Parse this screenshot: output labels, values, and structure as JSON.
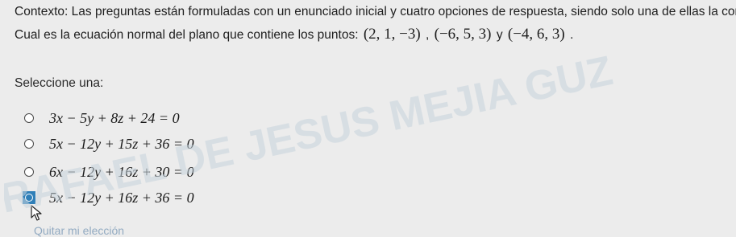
{
  "context": "Contexto: Las preguntas están formuladas con un enunciado inicial y cuatro opciones de respuesta, siendo solo una de ellas la corr",
  "question": {
    "text_before": "Cual es la ecuación normal del plano que contiene los puntos: ",
    "point_1": "(2, 1, −3)",
    "sep_1": " , ",
    "point_2": "(−6, 5, 3)",
    "sep_2": " y ",
    "point_3": "(−4, 6, 3)",
    "text_after": " ."
  },
  "select_label": "Seleccione una:",
  "options": [
    {
      "equation": "3x − 5y + 8z + 24 = 0",
      "selected": false
    },
    {
      "equation": "5x − 12y + 15z + 36 = 0",
      "selected": false
    },
    {
      "equation": "6x − 12y + 16z + 30 = 0",
      "selected": false
    },
    {
      "equation": "5x − 12y + 16z + 36 = 0",
      "selected": true
    }
  ],
  "clear_choice": "Quitar mi elección",
  "watermark": "RAFAEL DE JESUS MEJIA GUZ",
  "colors": {
    "background": "#ececec",
    "selected_accent": "#2f7fb8",
    "watermark": "#c7d3dc",
    "link": "#6c8fb0"
  }
}
